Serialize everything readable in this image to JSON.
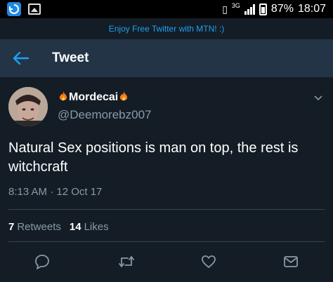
{
  "status_bar": {
    "network": "3G",
    "battery": "87%",
    "time": "18:07",
    "icons": [
      "app-icon",
      "gallery-icon",
      "vibrate-icon",
      "signal-icon",
      "battery-icon"
    ]
  },
  "promo": {
    "text": "Enjoy Free Twitter with MTN! :)"
  },
  "header": {
    "title": "Tweet",
    "back_icon": "arrow-left-icon"
  },
  "tweet": {
    "display_name": "Mordecai",
    "handle": "@Deemorebz007",
    "text": "Natural Sex positions is man on top, the rest is witchcraft",
    "timestamp": "8:13 AM · 12 Oct 17",
    "retweets_count": "7",
    "retweets_label": "Retweets",
    "likes_count": "14",
    "likes_label": "Likes"
  },
  "actions": [
    "reply-icon",
    "retweet-icon",
    "like-icon",
    "share-icon"
  ],
  "colors": {
    "background": "#141d26",
    "header": "#243447",
    "accent": "#1da1f2",
    "secondary_text": "#8899a6",
    "divider": "#38444d"
  }
}
